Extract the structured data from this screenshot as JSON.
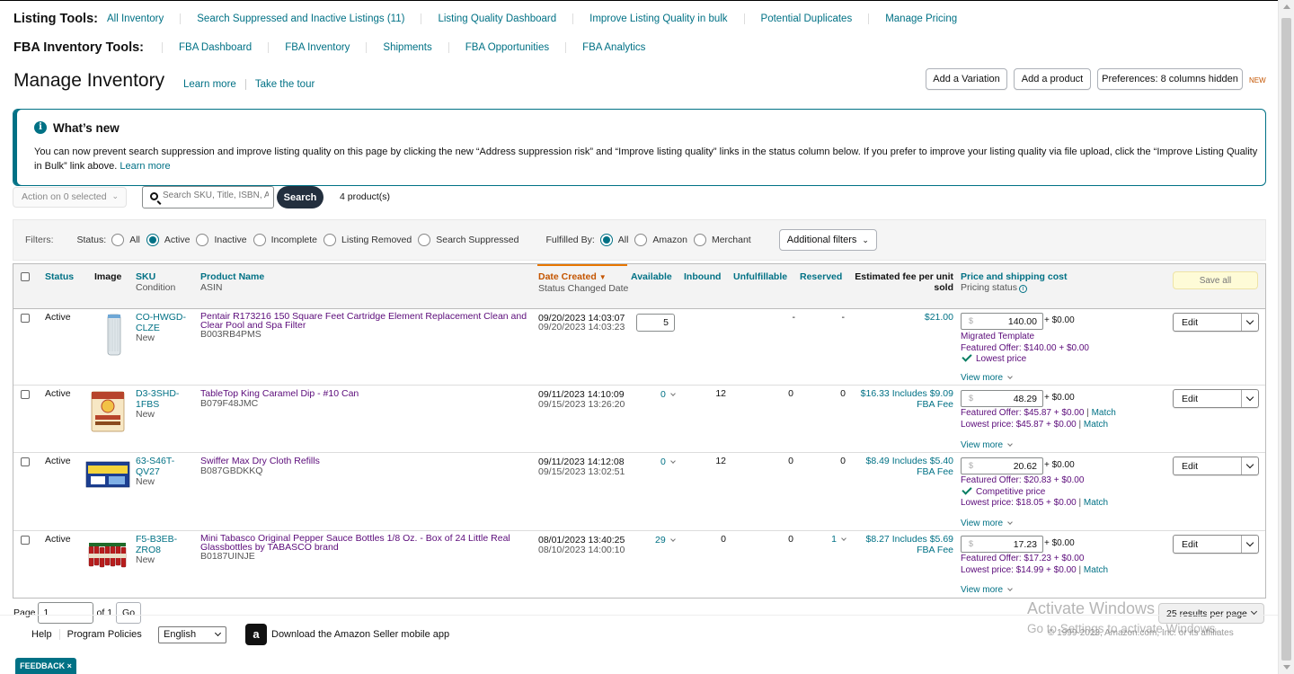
{
  "listing_tools": {
    "title": "Listing Tools:",
    "links": [
      "All Inventory",
      "Search Suppressed and Inactive Listings (11)",
      "Listing Quality Dashboard",
      "Improve Listing Quality in bulk",
      "Potential Duplicates",
      "Manage Pricing"
    ]
  },
  "fba_tools": {
    "title": "FBA Inventory Tools:",
    "links": [
      "FBA Dashboard",
      "FBA Inventory",
      "Shipments",
      "FBA Opportunities",
      "FBA Analytics"
    ]
  },
  "page": {
    "title": "Manage Inventory",
    "learn_more": "Learn more",
    "take_tour": "Take the tour"
  },
  "header_buttons": {
    "add_variation": "Add a Variation",
    "add_product": "Add a product",
    "preferences": "Preferences: 8 columns hidden",
    "new_badge": "NEW"
  },
  "whats_new": {
    "title": "What’s new",
    "body": "You can now prevent search suppression and improve listing quality on this page by clicking the new “Address suppression risk” and “Improve listing quality” links in the status column below. If you prefer to improve your listing quality via file upload, click the “Improve Listing Quality in Bulk” link above.",
    "link": "Learn more"
  },
  "toolbar": {
    "action": "Action on 0 selected",
    "search_placeholder": "Search SKU, Title, ISBN, ASIN",
    "search_button": "Search",
    "product_count": "4 product(s)"
  },
  "filters": {
    "label": "Filters:",
    "status_label": "Status:",
    "status_options": [
      "All",
      "Active",
      "Inactive",
      "Incomplete",
      "Listing Removed",
      "Search Suppressed"
    ],
    "status_selected": "Active",
    "fulfilled_label": "Fulfilled By:",
    "fulfilled_options": [
      "All",
      "Amazon",
      "Merchant"
    ],
    "fulfilled_selected": "All",
    "additional_filters": "Additional filters"
  },
  "columns": {
    "status": "Status",
    "image": "Image",
    "sku": "SKU",
    "condition": "Condition",
    "product_name": "Product Name",
    "asin": "ASIN",
    "date_created": "Date Created",
    "status_changed": "Status Changed Date",
    "available": "Available",
    "inbound": "Inbound",
    "unfulfillable": "Unfulfillable",
    "reserved": "Reserved",
    "est_fee": "Estimated fee per unit sold",
    "price_ship": "Price and shipping cost",
    "pricing_status": "Pricing status",
    "save_all": "Save all"
  },
  "rows": [
    {
      "status": "Active",
      "sku": "CO-HWGD-CLZE",
      "condition": "New",
      "title": "Pentair R173216 150 Square Feet Cartridge Element Replacement Clean and Clear Pool and Spa Filter",
      "asin": "B003RB4PMS",
      "date_created": "09/20/2023 14:03:07",
      "status_changed": "09/20/2023 14:03:23",
      "available": "5",
      "inbound": "",
      "unfulfillable": "-",
      "reserved": "-",
      "fee": "$21.00",
      "price": "140.00",
      "currency": "$",
      "shipping": "+ $0.00",
      "lines": [
        {
          "text": "Migrated Template",
          "tone": "purple"
        },
        {
          "text": "Featured Offer: $140.00 + $0.00",
          "tone": "purple"
        },
        {
          "text": "Lowest price",
          "tone": "check"
        }
      ],
      "view_more": "View more",
      "edit": "Edit"
    },
    {
      "status": "Active",
      "sku": "D3-3SHD-1FBS",
      "condition": "New",
      "title": "TableTop King Caramel Dip - #10 Can",
      "asin": "B079F48JMC",
      "date_created": "09/11/2023 14:10:09",
      "status_changed": "09/15/2023 13:26:20",
      "available": "0",
      "inbound": "12",
      "unfulfillable": "0",
      "reserved": "0",
      "fee": "$16.33 Includes $9.09 FBA Fee",
      "price": "48.29",
      "currency": "$",
      "shipping": "+ $0.00",
      "lines": [
        {
          "text": "Featured Offer: $45.87 + $0.00",
          "tone": "purple",
          "match": "Match"
        },
        {
          "text": "Lowest price: $45.87 + $0.00",
          "tone": "purple",
          "match": "Match"
        }
      ],
      "view_more": "View more",
      "edit": "Edit"
    },
    {
      "status": "Active",
      "sku": "63-S46T-QV27",
      "condition": "New",
      "title": "Swiffer Max Dry Cloth Refills",
      "asin": "B087GBDKKQ",
      "date_created": "09/11/2023 14:12:08",
      "status_changed": "09/15/2023 13:02:51",
      "available": "0",
      "inbound": "12",
      "unfulfillable": "0",
      "reserved": "0",
      "fee": "$8.49 Includes $5.40 FBA Fee",
      "price": "20.62",
      "currency": "$",
      "shipping": "+ $0.00",
      "lines": [
        {
          "text": "Featured Offer: $20.83 + $0.00",
          "tone": "purple"
        },
        {
          "text": "Competitive price",
          "tone": "check"
        },
        {
          "text": "Lowest price: $18.05 + $0.00",
          "tone": "purple",
          "match": "Match"
        }
      ],
      "view_more": "View more",
      "edit": "Edit"
    },
    {
      "status": "Active",
      "sku": "F5-B3EB-ZRO8",
      "condition": "New",
      "title": "Mini Tabasco Original Pepper Sauce Bottles 1/8 Oz. - Box of 24 Little Real Glassbottles by TABASCO brand",
      "asin": "B0187UINJE",
      "date_created": "08/01/2023 13:40:25",
      "status_changed": "08/10/2023 14:00:10",
      "available": "29",
      "inbound": "0",
      "unfulfillable": "0",
      "reserved": "1",
      "fee": "$8.27 Includes $5.69 FBA Fee",
      "price": "17.23",
      "currency": "$",
      "shipping": "+ $0.00",
      "lines": [
        {
          "text": "Featured Offer: $17.23 + $0.00",
          "tone": "purple"
        },
        {
          "text": "Lowest price: $14.99 + $0.00",
          "tone": "purple",
          "match": "Match"
        }
      ],
      "view_more": "View more",
      "edit": "Edit"
    }
  ],
  "pager": {
    "page_label": "Page",
    "page_value": "1",
    "of_label": "of 1",
    "go": "Go",
    "per_page": "25 results per page"
  },
  "footer": {
    "help": "Help",
    "program_policies": "Program Policies",
    "language": "English",
    "app_text": "Download the Amazon Seller mobile app",
    "copyright": "© 1999-2023, Amazon.com, Inc. or its affiliates",
    "feedback": "FEEDBACK ×"
  },
  "watermark": {
    "line1": "Activate Windows",
    "line2": "Go to Settings to activate Windows."
  }
}
